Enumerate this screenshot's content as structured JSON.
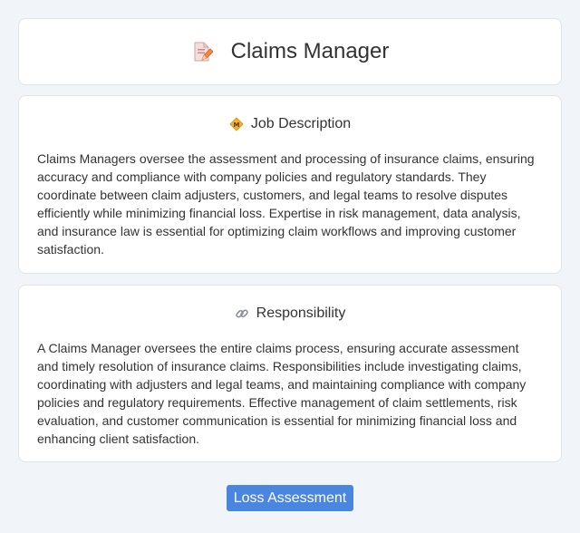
{
  "header": {
    "title": "Claims Manager",
    "icon": "document-pencil-icon"
  },
  "job_description": {
    "heading": "Job Description",
    "icon": "diamond-badge-icon",
    "text": "Claims Managers oversee the assessment and processing of insurance claims, ensuring accuracy and compliance with company policies and regulatory standards. They coordinate between claim adjusters, customers, and legal teams to resolve disputes efficiently while minimizing financial loss. Expertise in risk management, data analysis, and insurance law is essential for optimizing claim workflows and improving customer satisfaction."
  },
  "responsibility": {
    "heading": "Responsibility",
    "icon": "link-icon",
    "text": "A Claims Manager oversees the entire claims process, ensuring accurate assessment and timely resolution of insurance claims. Responsibilities include investigating claims, coordinating with adjusters and legal teams, and maintaining compliance with company policies and regulatory requirements. Effective management of claim settlements, risk evaluation, and customer communication is essential for minimizing financial loss and enhancing client satisfaction."
  },
  "tag": {
    "label": "Loss Assessment",
    "color": "#4a86e0"
  }
}
